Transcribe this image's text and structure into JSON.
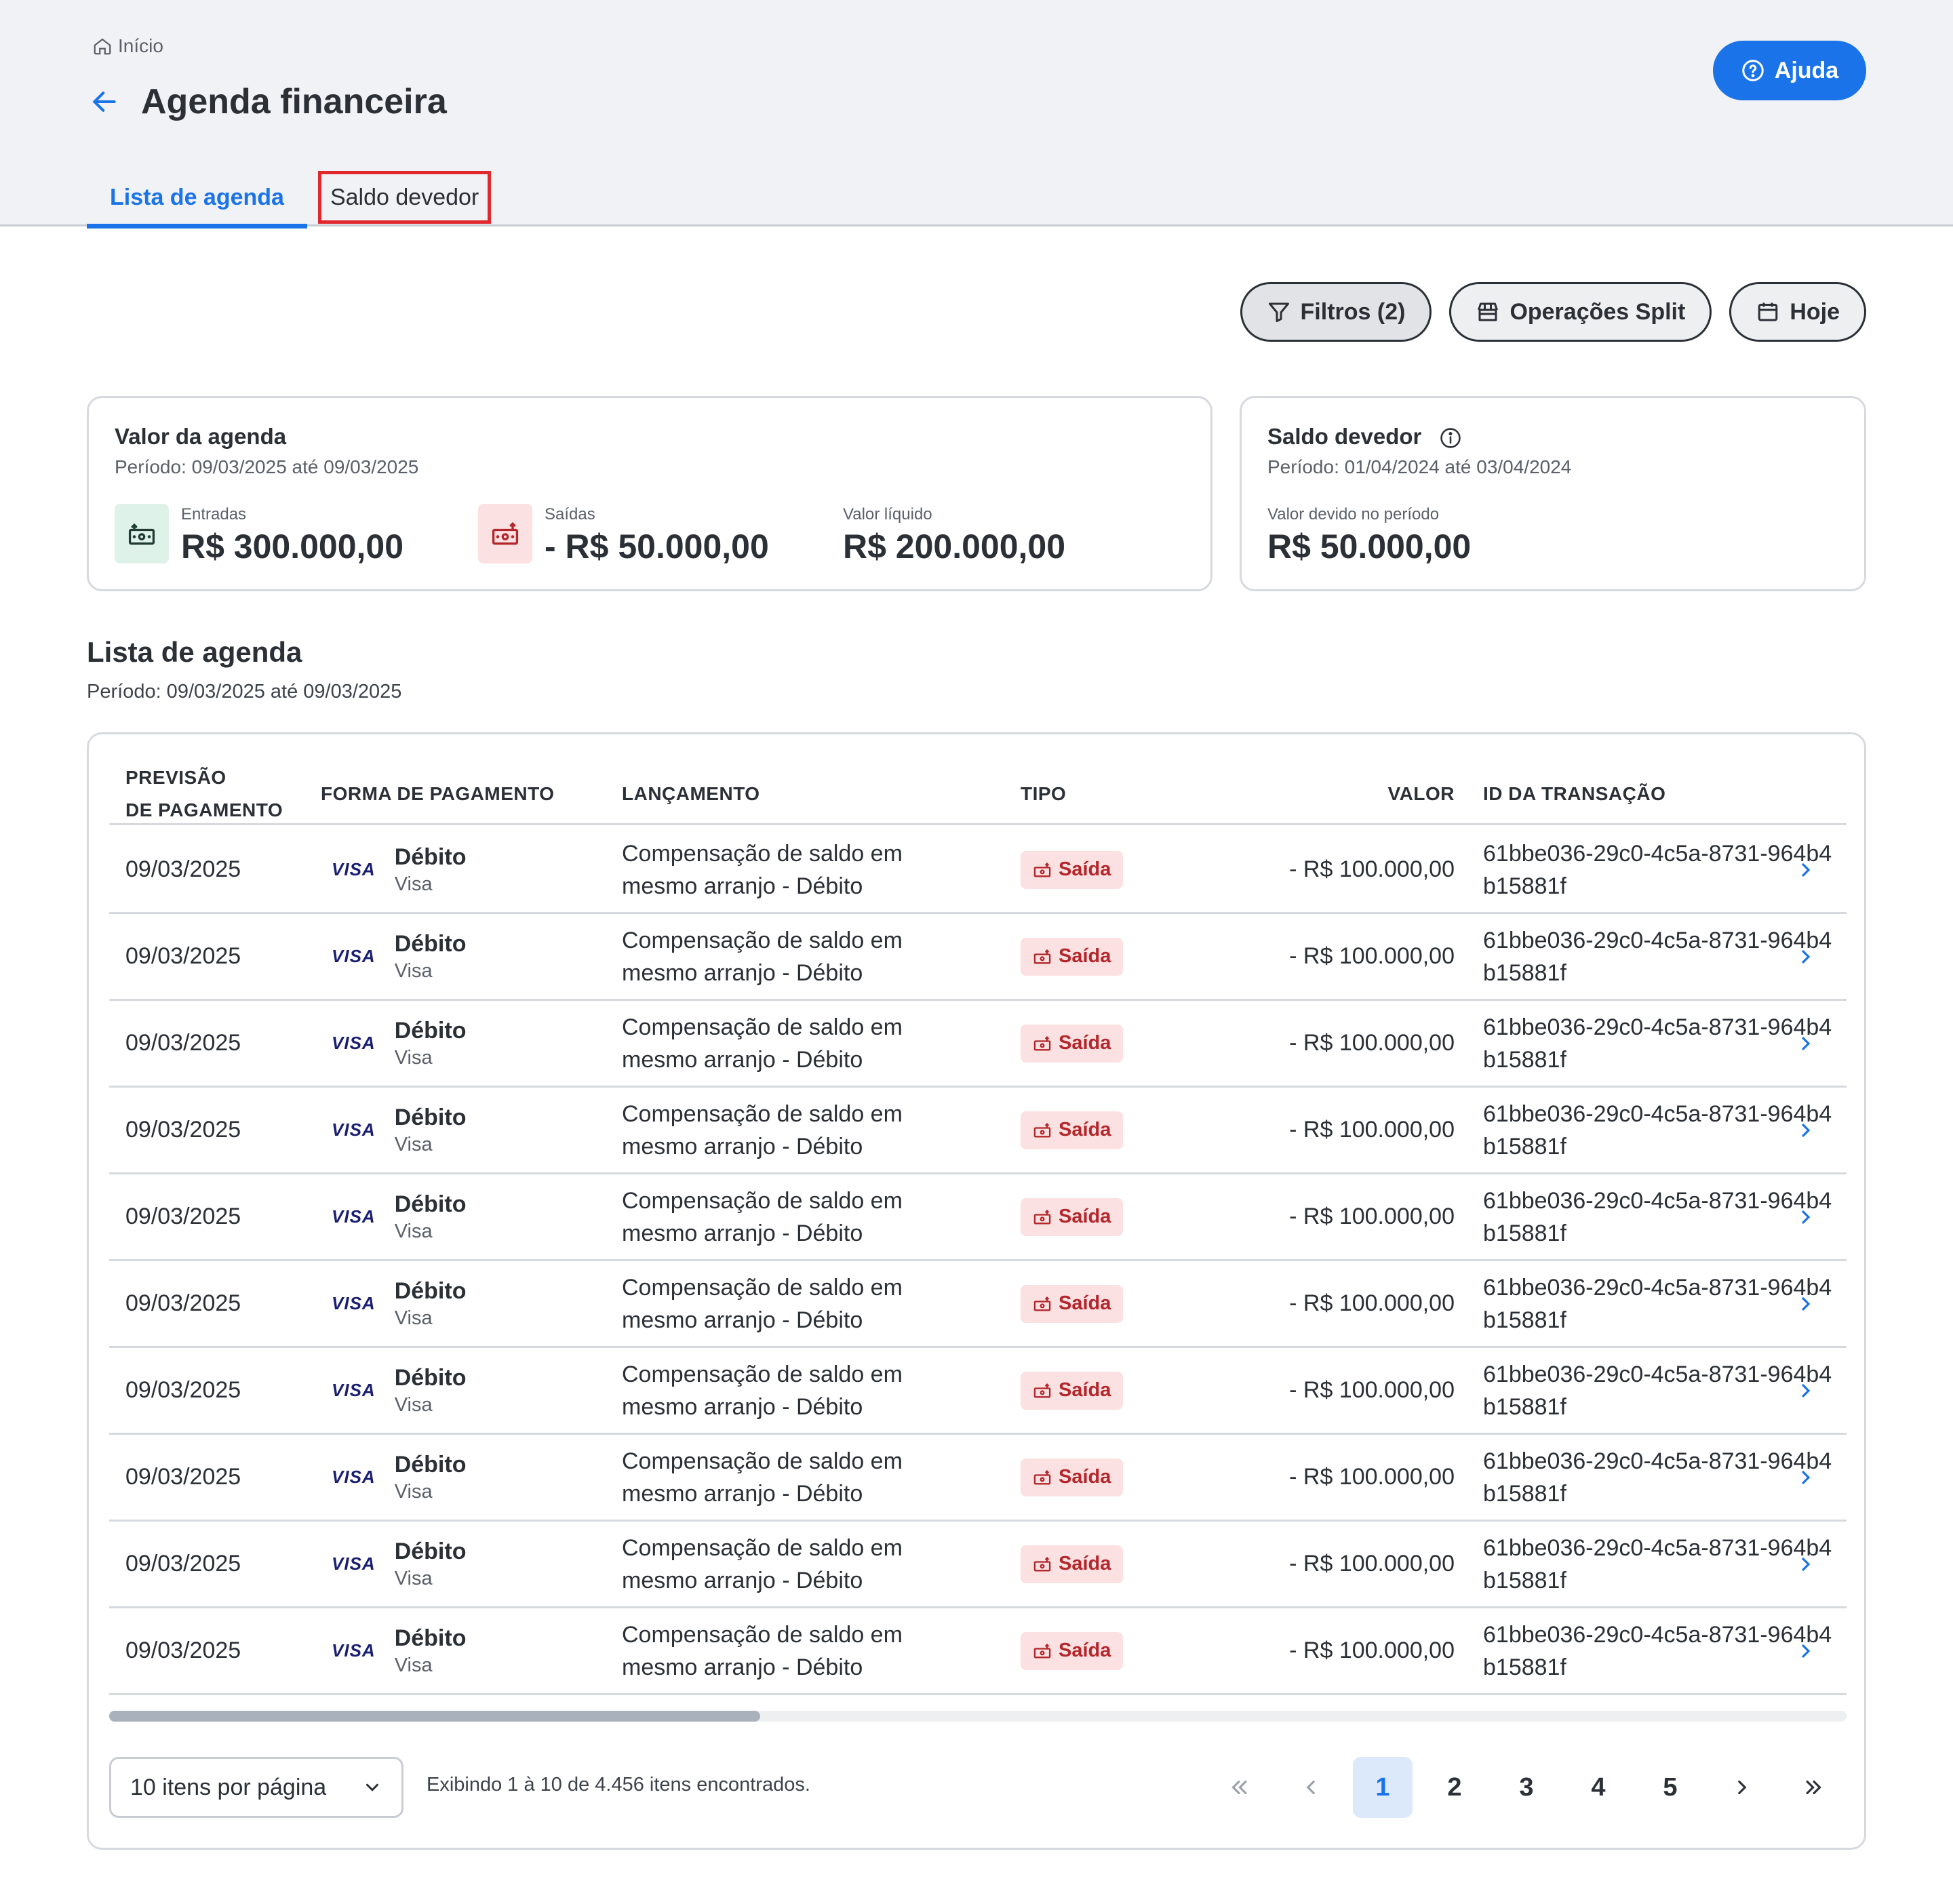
{
  "breadcrumb": {
    "home_label": "Início"
  },
  "page": {
    "title": "Agenda financeira"
  },
  "help_button": {
    "label": "Ajuda"
  },
  "tabs": [
    {
      "label": "Lista de agenda"
    },
    {
      "label": "Saldo devedor"
    }
  ],
  "actions": {
    "filters_label": "Filtros (2)",
    "split_label": "Operações Split",
    "today_label": "Hoje"
  },
  "summary": {
    "title": "Valor da agenda",
    "period": "Período: 09/03/2025 até 09/03/2025",
    "entradas_label": "Entradas",
    "entradas_value": "R$ 300.000,00",
    "saidas_label": "Saídas",
    "saidas_value": "- R$ 50.000,00",
    "liquido_label": "Valor líquido",
    "liquido_value": "R$ 200.000,00"
  },
  "saldo": {
    "title": "Saldo devedor",
    "period": "Período: 01/04/2024 até 03/04/2024",
    "devido_label": "Valor devido no período",
    "devido_value": "R$ 50.000,00"
  },
  "list": {
    "title": "Lista de agenda",
    "period": "Período: 09/03/2025 até 09/03/2025"
  },
  "table": {
    "headers": {
      "previsao_1": "PREVISÃO",
      "previsao_2": "DE PAGAMENTO",
      "forma": "FORMA DE PAGAMENTO",
      "lancamento": "LANÇAMENTO",
      "tipo": "TIPO",
      "valor": "VALOR",
      "id": "ID DA TRANSAÇÃO"
    },
    "rows": [
      {
        "date": "09/03/2025",
        "brand": "VISA",
        "method": "Débito",
        "method_sub": "Visa",
        "launch": "Compensação de saldo em mesmo arranjo - Débito",
        "type": "Saída",
        "value": "- R$ 100.000,00",
        "id": "61bbe036-29c0-4c5a-8731-964b4b15881f"
      },
      {
        "date": "09/03/2025",
        "brand": "VISA",
        "method": "Débito",
        "method_sub": "Visa",
        "launch": "Compensação de saldo em mesmo arranjo - Débito",
        "type": "Saída",
        "value": "- R$ 100.000,00",
        "id": "61bbe036-29c0-4c5a-8731-964b4b15881f"
      },
      {
        "date": "09/03/2025",
        "brand": "VISA",
        "method": "Débito",
        "method_sub": "Visa",
        "launch": "Compensação de saldo em mesmo arranjo - Débito",
        "type": "Saída",
        "value": "- R$ 100.000,00",
        "id": "61bbe036-29c0-4c5a-8731-964b4b15881f"
      },
      {
        "date": "09/03/2025",
        "brand": "VISA",
        "method": "Débito",
        "method_sub": "Visa",
        "launch": "Compensação de saldo em mesmo arranjo - Débito",
        "type": "Saída",
        "value": "- R$ 100.000,00",
        "id": "61bbe036-29c0-4c5a-8731-964b4b15881f"
      },
      {
        "date": "09/03/2025",
        "brand": "VISA",
        "method": "Débito",
        "method_sub": "Visa",
        "launch": "Compensação de saldo em mesmo arranjo - Débito",
        "type": "Saída",
        "value": "- R$ 100.000,00",
        "id": "61bbe036-29c0-4c5a-8731-964b4b15881f"
      },
      {
        "date": "09/03/2025",
        "brand": "VISA",
        "method": "Débito",
        "method_sub": "Visa",
        "launch": "Compensação de saldo em mesmo arranjo - Débito",
        "type": "Saída",
        "value": "- R$ 100.000,00",
        "id": "61bbe036-29c0-4c5a-8731-964b4b15881f"
      },
      {
        "date": "09/03/2025",
        "brand": "VISA",
        "method": "Débito",
        "method_sub": "Visa",
        "launch": "Compensação de saldo em mesmo arranjo - Débito",
        "type": "Saída",
        "value": "- R$ 100.000,00",
        "id": "61bbe036-29c0-4c5a-8731-964b4b15881f"
      },
      {
        "date": "09/03/2025",
        "brand": "VISA",
        "method": "Débito",
        "method_sub": "Visa",
        "launch": "Compensação de saldo em mesmo arranjo - Débito",
        "type": "Saída",
        "value": "- R$ 100.000,00",
        "id": "61bbe036-29c0-4c5a-8731-964b4b15881f"
      },
      {
        "date": "09/03/2025",
        "brand": "VISA",
        "method": "Débito",
        "method_sub": "Visa",
        "launch": "Compensação de saldo em mesmo arranjo - Débito",
        "type": "Saída",
        "value": "- R$ 100.000,00",
        "id": "61bbe036-29c0-4c5a-8731-964b4b15881f"
      },
      {
        "date": "09/03/2025",
        "brand": "VISA",
        "method": "Débito",
        "method_sub": "Visa",
        "launch": "Compensação de saldo em mesmo arranjo - Débito",
        "type": "Saída",
        "value": "- R$ 100.000,00",
        "id": "61bbe036-29c0-4c5a-8731-964b4b15881f"
      }
    ]
  },
  "pagination": {
    "per_page_label": "10 itens por página",
    "showing_text": "Exibindo 1 à 10 de 4.456 itens encontrados.",
    "pages": [
      "1",
      "2",
      "3",
      "4",
      "5"
    ],
    "current_page": "1"
  },
  "colors": {
    "primary": "#1a73e8",
    "danger_bg": "#fbe1e1",
    "danger_text": "#b3262b",
    "success_bg": "#dff2e9",
    "highlight_outline": "#e0282d"
  }
}
